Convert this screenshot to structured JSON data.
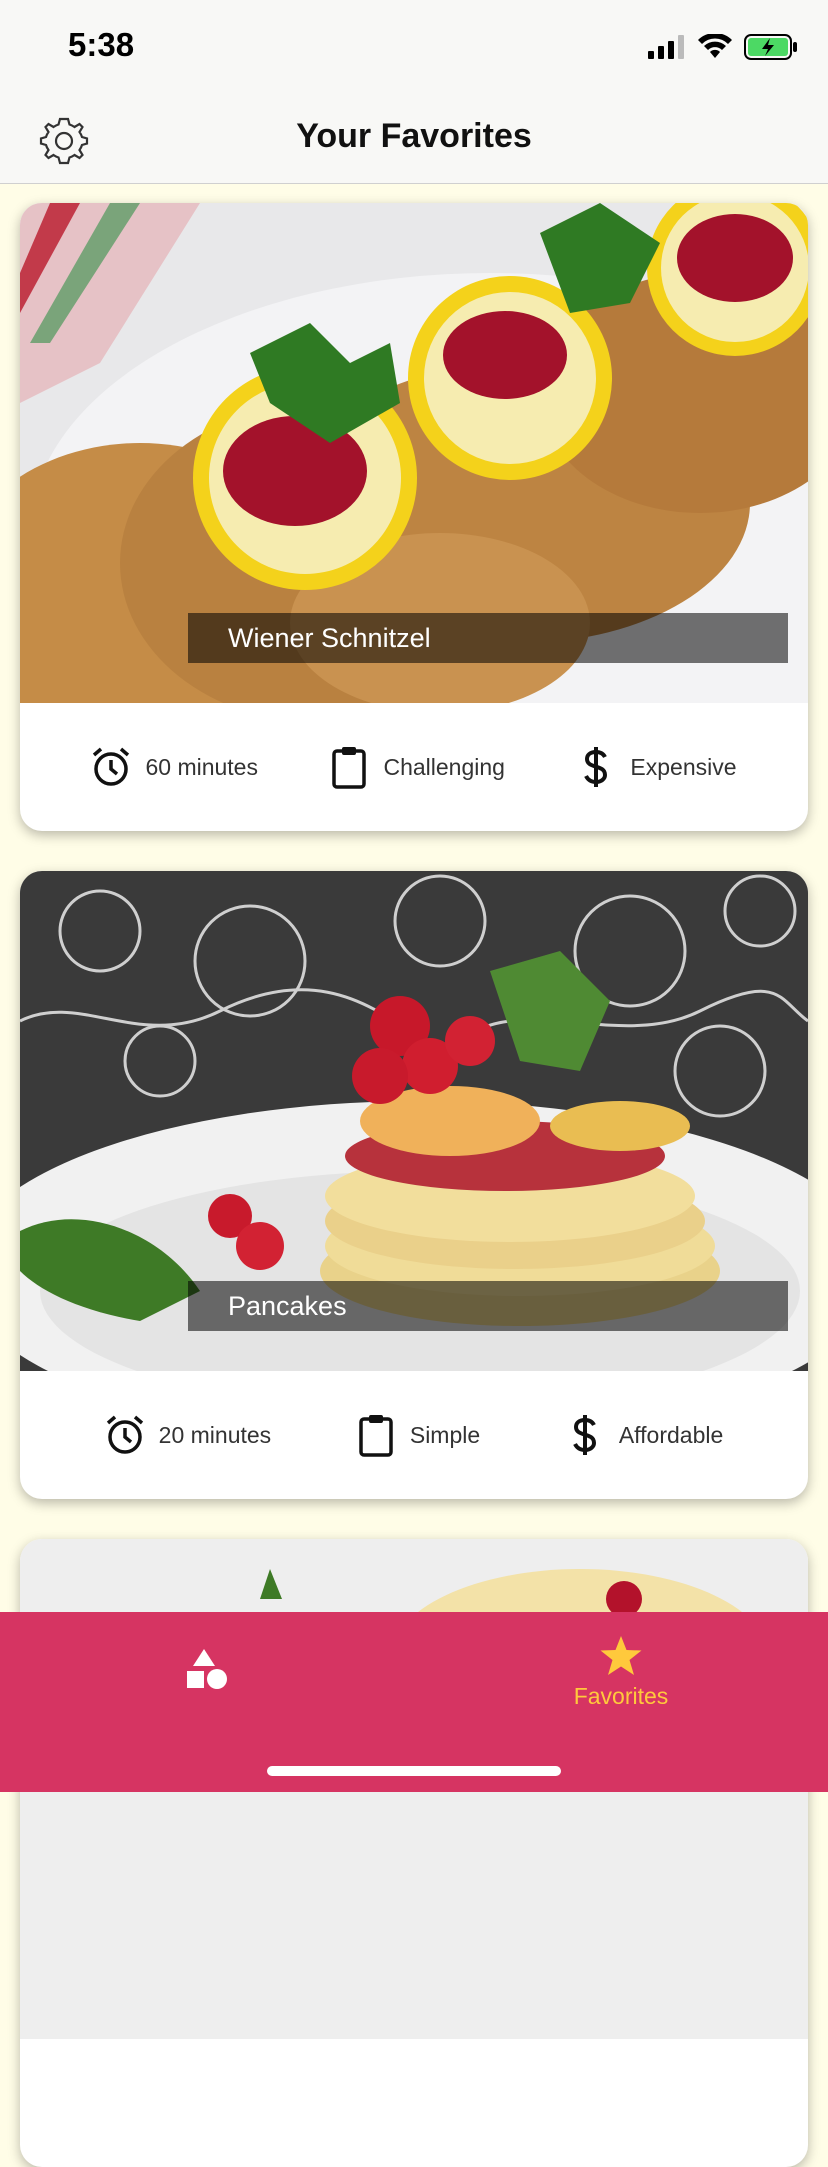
{
  "status": {
    "time": "5:38"
  },
  "header": {
    "title": "Your Favorites",
    "settings_icon": "gear-icon"
  },
  "meals": [
    {
      "title": "Wiener Schnitzel",
      "duration": "60 minutes",
      "complexity": "Challenging",
      "affordability": "Expensive"
    },
    {
      "title": "Pancakes",
      "duration": "20 minutes",
      "complexity": "Simple",
      "affordability": "Affordable"
    }
  ],
  "tabs": [
    {
      "icon": "categories-shapes-icon",
      "label": ""
    },
    {
      "icon": "star-icon",
      "label": "Favorites"
    }
  ],
  "colors": {
    "accent": "#d63462",
    "active_tab": "#ffc93c",
    "background": "#fffde7"
  }
}
